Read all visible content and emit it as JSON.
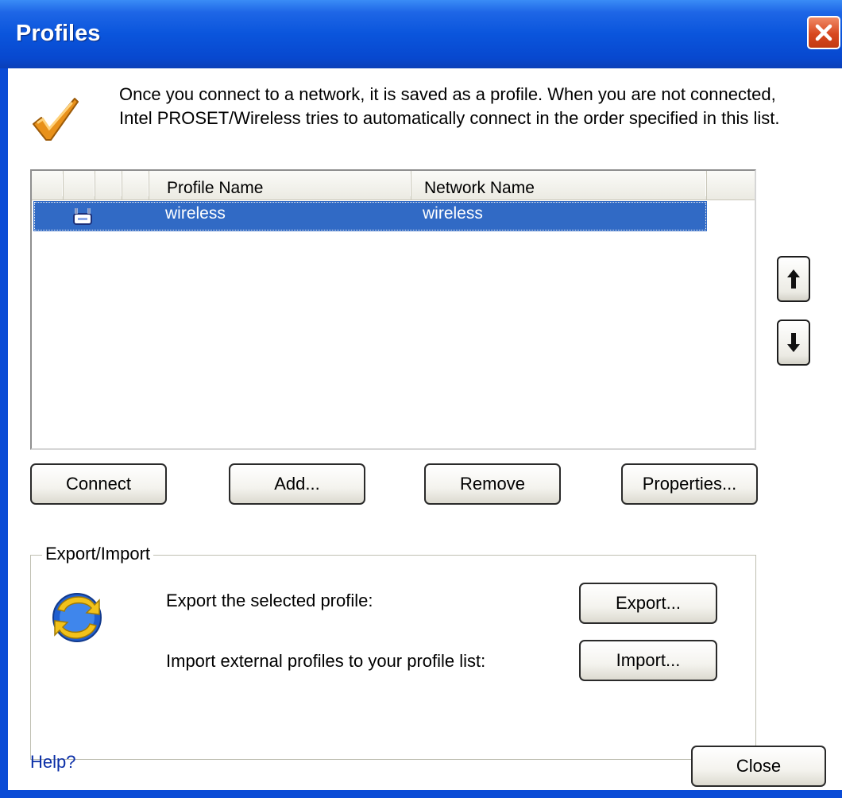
{
  "window": {
    "title": "Profiles"
  },
  "intro": {
    "text": "Once you connect to a network, it is saved as a profile. When you are not connected, Intel PROSET/Wireless tries to automatically connect in the order specified in this list."
  },
  "profile_list": {
    "columns": [
      "Profile Name",
      "Network Name"
    ],
    "rows": [
      {
        "profile_name": "wireless",
        "network_name": "wireless",
        "selected": true
      }
    ]
  },
  "buttons": {
    "connect": "Connect",
    "add": "Add...",
    "remove": "Remove",
    "properties": "Properties...",
    "close": "Close"
  },
  "export_import": {
    "group_label": "Export/Import",
    "export_text": "Export the selected profile:",
    "import_text": "Import external profiles to your profile list:",
    "export_button": "Export...",
    "import_button": "Import..."
  },
  "help": {
    "label": "Help?"
  },
  "icons": {
    "checkmark": "checkmark-icon",
    "close": "close-icon",
    "profile": "wireless-profile-icon",
    "move_up": "arrow-up-icon",
    "move_down": "arrow-down-icon",
    "export_import": "export-import-icon"
  },
  "colors": {
    "titlebar": "#0a55dc",
    "close_button": "#d8481f",
    "selection": "#316ac5",
    "help_link": "#0b2fa8"
  }
}
